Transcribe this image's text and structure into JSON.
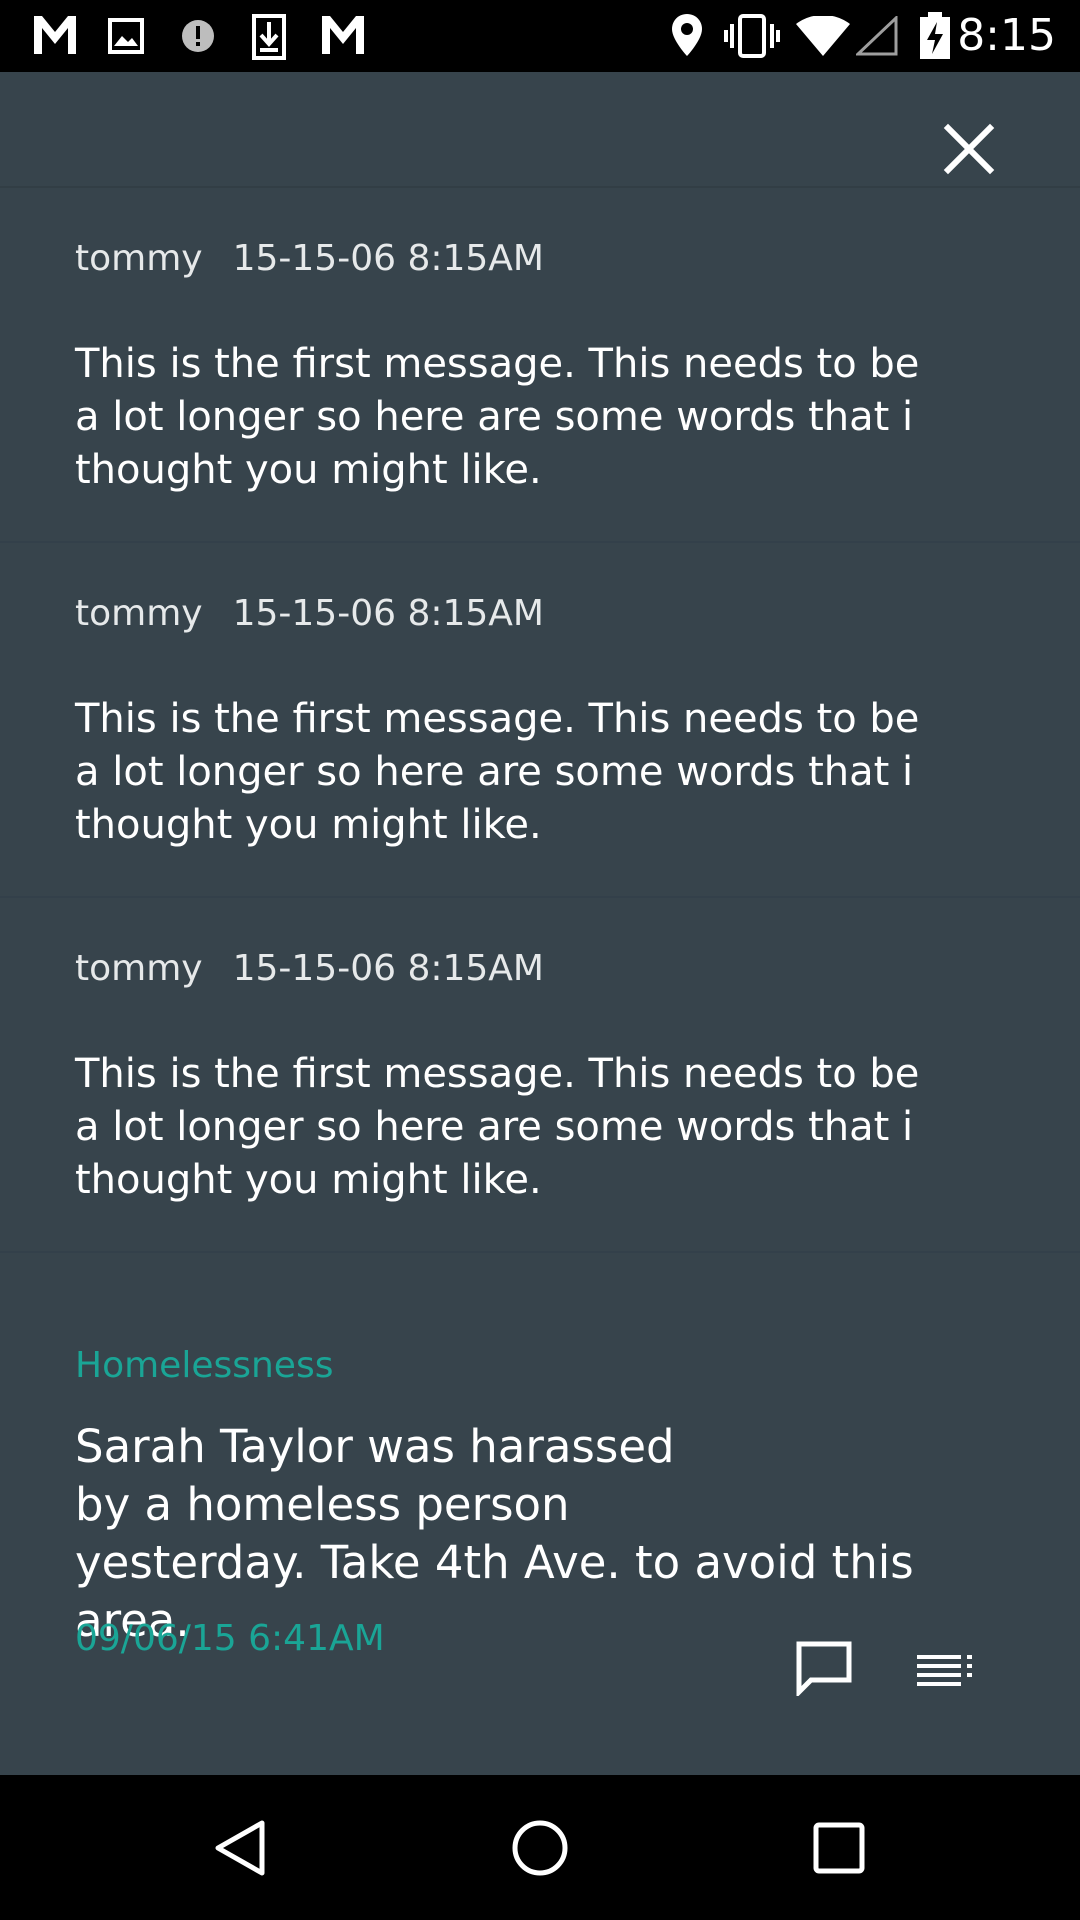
{
  "status_bar": {
    "time": "8:15",
    "left_icons": [
      "gmail-icon",
      "photo-icon",
      "alert-icon",
      "download-icon",
      "gmail-icon"
    ],
    "right_icons": [
      "location-icon",
      "vibrate-icon",
      "wifi-icon",
      "signal-icon",
      "battery-charging-icon"
    ]
  },
  "header": {
    "close_icon": "close-icon"
  },
  "messages": [
    {
      "author": "tommy",
      "timestamp": "15-15-06 8:15AM",
      "body": "This is the first message. This needs to be a lot longer so here are some words that i thought you might like."
    },
    {
      "author": "tommy",
      "timestamp": "15-15-06 8:15AM",
      "body": "This is the first message. This needs to be a lot longer so here are some words that i thought you might like."
    },
    {
      "author": "tommy",
      "timestamp": "15-15-06 8:15AM",
      "body": "This is the first message. This needs to be a lot longer so here are some words that i thought you might like."
    }
  ],
  "report": {
    "category": "Homelessness",
    "body_lines": [
      "Sarah Taylor was harassed",
      "by a homeless person",
      "yesterday. Take 4th Ave. to avoid this area."
    ],
    "timestamp": "09/06/15 6:41AM",
    "actions": [
      "comment-icon",
      "menu-list-icon"
    ]
  },
  "colors": {
    "background": "#37444c",
    "accent": "#1aa596",
    "bars": "#000000"
  }
}
